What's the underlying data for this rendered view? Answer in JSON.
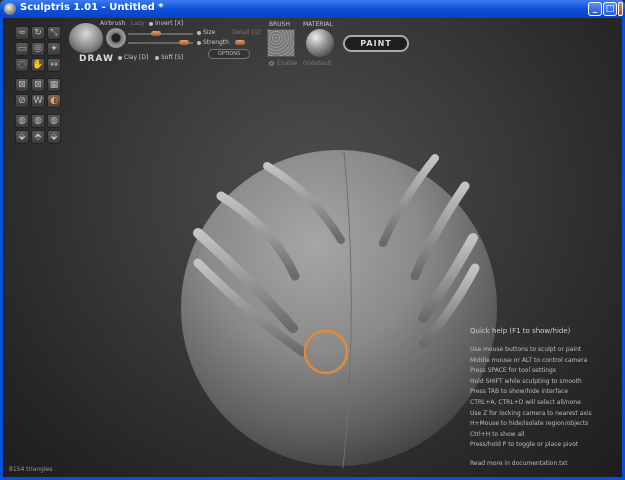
{
  "window": {
    "title": "Sculptris 1.01 - Untitled *",
    "buttons": {
      "minimize": "_",
      "maximize": "□",
      "close": "×"
    }
  },
  "toolbar": {
    "brush_name": "DRAW",
    "airbrush": "Airbrush",
    "lazy": "Lazy",
    "invert": "Invert [X]",
    "size": "Size",
    "strength": "Strength",
    "detail": "Detail [Q]",
    "clay": "Clay [D]",
    "soft": "Soft [S]",
    "options": "OPTIONS",
    "brush_header": "BRUSH",
    "material_header": "MATERIAL",
    "enable": "Enable",
    "material_name": "00default",
    "paint": "PAINT",
    "size_value": 0.35,
    "strength_value": 0.75
  },
  "tools": [
    {
      "icon": "crease-icon",
      "glyph": "≈"
    },
    {
      "icon": "rotate-icon",
      "glyph": "↻"
    },
    {
      "icon": "scale-icon",
      "glyph": "⤡"
    },
    {
      "icon": "flatten-icon",
      "glyph": "▭"
    },
    {
      "icon": "inflate-icon",
      "glyph": "◎"
    },
    {
      "icon": "pinch-icon",
      "glyph": "✦"
    },
    {
      "icon": "smooth-icon",
      "glyph": "◌"
    },
    {
      "icon": "grab-icon",
      "glyph": "✋"
    },
    {
      "icon": "symmetry-icon",
      "glyph": "↔"
    },
    {
      "icon": "wireframe-icon",
      "glyph": "⊠"
    },
    {
      "icon": "grid-icon",
      "glyph": "▦"
    },
    {
      "icon": "reduce-icon",
      "glyph": "⊘"
    },
    {
      "icon": "mask-icon",
      "glyph": "W"
    },
    {
      "icon": "paint-mode-icon",
      "glyph": "◐"
    },
    {
      "icon": "subdivide-icon",
      "glyph": "◍"
    },
    {
      "icon": "import-icon",
      "glyph": "⬙"
    },
    {
      "icon": "export-icon",
      "glyph": "⬘"
    }
  ],
  "help": {
    "title": "Quick help (F1 to show/hide)",
    "lines": [
      "Use mouse buttons to sculpt or paint",
      "Middle mouse or ALT to control camera",
      "Press SPACE for tool settings",
      "Hold SHIFT while sculpting to smooth",
      "Press TAB to show/hide interface",
      "CTRL+A, CTRL+D will select all/none",
      "Use Z for locking camera to nearest axis",
      "H+Mouse to hide/isolate region/objects",
      "Ctrl+H to show all",
      "Press/hold P to toggle or place pivot"
    ],
    "footer": "Read more in documentation.txt"
  },
  "status": {
    "triangles": "8154 triangles"
  },
  "colors": {
    "accent": "#e08a3c",
    "titlebar": "#0a4fd8",
    "background": "#2a2a2a"
  }
}
